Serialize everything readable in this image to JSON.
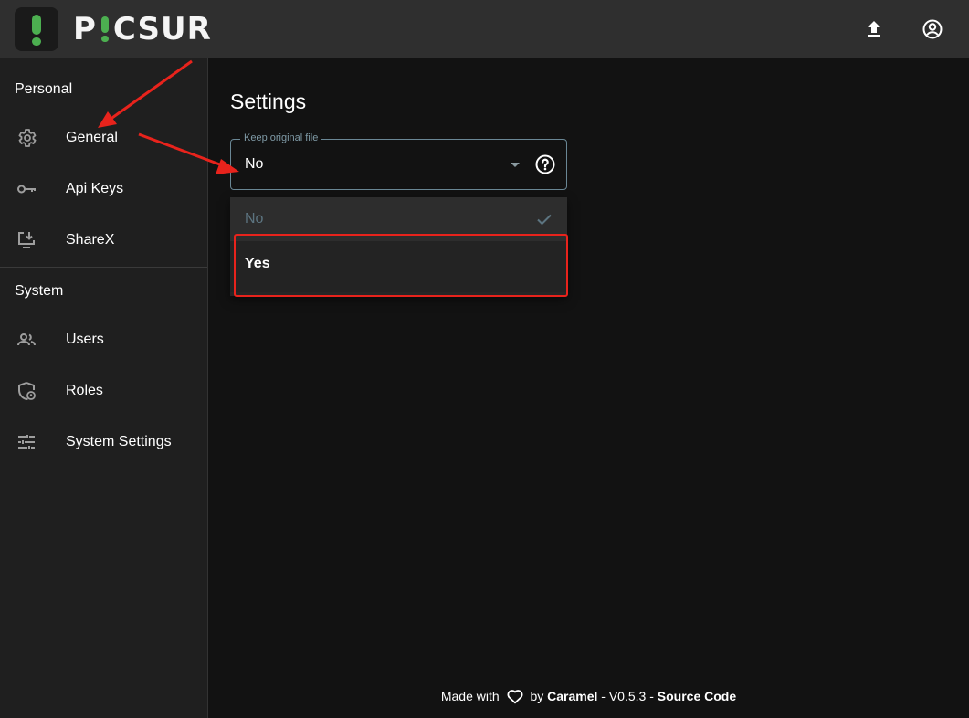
{
  "brand": {
    "name_p": "P",
    "name_rest": "CSUR",
    "accent": "#4caf50"
  },
  "topbar": {
    "upload_icon": "upload-icon",
    "account_icon": "account-circle-icon"
  },
  "sidebar": {
    "personal_title": "Personal",
    "system_title": "System",
    "personal_items": [
      {
        "label": "General",
        "icon": "gear-icon"
      },
      {
        "label": "Api Keys",
        "icon": "key-icon"
      },
      {
        "label": "ShareX",
        "icon": "monitor-download-icon"
      }
    ],
    "system_items": [
      {
        "label": "Users",
        "icon": "users-icon"
      },
      {
        "label": "Roles",
        "icon": "shield-lock-icon"
      },
      {
        "label": "System Settings",
        "icon": "sliders-icon"
      }
    ]
  },
  "main": {
    "title": "Settings",
    "field": {
      "label": "Keep original file",
      "value": "No"
    },
    "dropdown": {
      "options": [
        {
          "label": "No",
          "selected": true
        },
        {
          "label": "Yes",
          "selected": false
        }
      ]
    }
  },
  "footer": {
    "made_with": "Made with",
    "by": "by",
    "author": "Caramel",
    "version": "- V0.5.3 -",
    "source": "Source Code"
  },
  "annotations": {
    "highlight_color": "#e8231c"
  }
}
